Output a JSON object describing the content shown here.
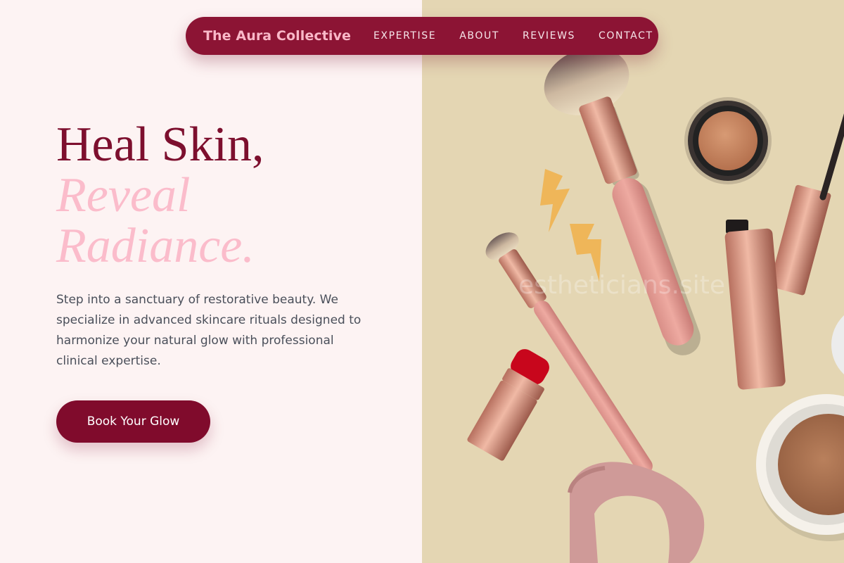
{
  "nav": {
    "brand": "The Aura Collective",
    "links": [
      {
        "label": "EXPERTISE"
      },
      {
        "label": "ABOUT"
      },
      {
        "label": "REVIEWS"
      },
      {
        "label": "CONTACT"
      }
    ]
  },
  "hero": {
    "line1": "Heal Skin,",
    "line2": "Reveal",
    "line3": "Radiance.",
    "description": "Step into a sanctuary of restorative beauty. We specialize in advanced skincare rituals designed to harmonize your natural glow with professional clinical expertise.",
    "cta_label": "Book Your Glow"
  },
  "image": {
    "watermark": "estheticians.site"
  },
  "colors": {
    "brand": "#8c1434",
    "accent_pink": "#fbbccb",
    "page_bg": "#fdf3f3",
    "image_bg": "#e4d6b3"
  }
}
